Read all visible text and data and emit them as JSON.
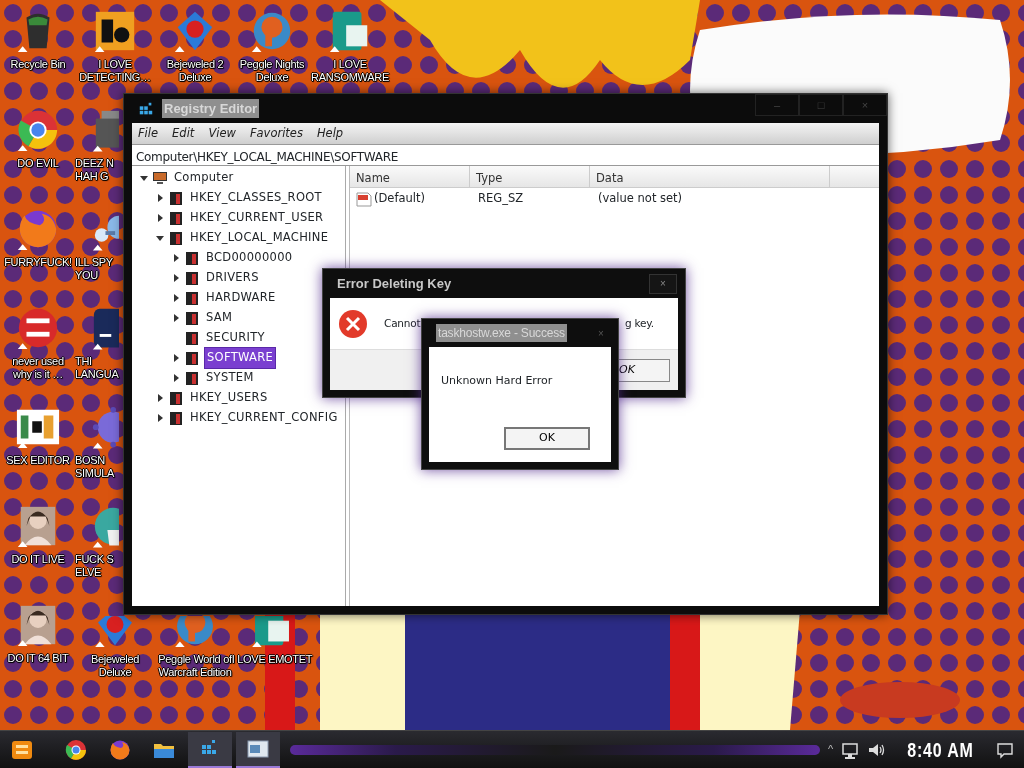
{
  "desktop": {
    "icons": [
      {
        "kind": "bin",
        "label": "Recycle Bin"
      },
      {
        "kind": "badge",
        "label": "I LOVE\nDETECTING…"
      },
      {
        "kind": "gem",
        "label": "Bejeweled 2\nDeluxe"
      },
      {
        "kind": "disc",
        "label": "Peggle Nights\nDeluxe"
      },
      {
        "kind": "sheet",
        "label": "I LOVE\nRANSOMWARE"
      },
      {
        "kind": "browser",
        "label": "DO EVIL"
      },
      {
        "kind": "stack",
        "label": "DEEZ N\nHAH G"
      },
      {
        "kind": "fox",
        "label": "FURRYFUCK!"
      },
      {
        "kind": "network",
        "label": "ILL SPY\nYOU"
      },
      {
        "kind": "redball",
        "label": "never used\nwhy is it …"
      },
      {
        "kind": "darktile",
        "label": "THI\nLANGUA"
      },
      {
        "kind": "hextile",
        "label": "SEX EDITOR"
      },
      {
        "kind": "spiky",
        "label": "BOSN\nSIMULA"
      },
      {
        "kind": "portrait",
        "label": "DO IT LIVE"
      },
      {
        "kind": "tealball",
        "label": "FUCK S\nELVE"
      },
      {
        "kind": "portrait",
        "label": "DO IT 64 BIT"
      },
      {
        "kind": "gem",
        "label": "Bejeweled\nDeluxe"
      },
      {
        "kind": "disc",
        "label": "Peggle World of\nWarcraft Edition"
      },
      {
        "kind": "sheet",
        "label": "I LOVE EMOTET"
      }
    ]
  },
  "registry_editor": {
    "title": "Registry Editor",
    "window_controls": [
      "–",
      "□",
      "×"
    ],
    "menu": [
      "File",
      "Edit",
      "View",
      "Favorites",
      "Help"
    ],
    "address": "Computer\\HKEY_LOCAL_MACHINE\\SOFTWARE",
    "tree": [
      {
        "label": "Computer",
        "kind": "computer",
        "has_subkeys": true,
        "expanded": true,
        "selected": false,
        "children": [
          {
            "label": "HKEY_CLASSES_ROOT",
            "has_subkeys": true,
            "expanded": false,
            "selected": false
          },
          {
            "label": "HKEY_CURRENT_USER",
            "has_subkeys": true,
            "expanded": false,
            "selected": false
          },
          {
            "label": "HKEY_LOCAL_MACHINE",
            "has_subkeys": true,
            "expanded": true,
            "selected": false,
            "children": [
              {
                "label": "BCD00000000",
                "has_subkeys": true,
                "expanded": false,
                "selected": false
              },
              {
                "label": "DRIVERS",
                "has_subkeys": true,
                "expanded": false,
                "selected": false
              },
              {
                "label": "HARDWARE",
                "has_subkeys": true,
                "expanded": false,
                "selected": false
              },
              {
                "label": "SAM",
                "has_subkeys": true,
                "expanded": false,
                "selected": false
              },
              {
                "label": "SECURITY",
                "has_subkeys": false,
                "selected": false
              },
              {
                "label": "SOFTWARE",
                "has_subkeys": true,
                "expanded": false,
                "selected": true
              },
              {
                "label": "SYSTEM",
                "has_subkeys": true,
                "expanded": false,
                "selected": false
              }
            ]
          },
          {
            "label": "HKEY_USERS",
            "has_subkeys": true,
            "expanded": false,
            "selected": false
          },
          {
            "label": "HKEY_CURRENT_CONFIG",
            "has_subkeys": true,
            "expanded": false,
            "selected": false
          }
        ]
      }
    ],
    "columns": [
      "Name",
      "Type",
      "Data"
    ],
    "rows": [
      {
        "name": "(Default)",
        "type": "REG_SZ",
        "data": "(value not set)"
      }
    ]
  },
  "error_dialog": {
    "title": "Error Deleting Key",
    "close": "×",
    "message_parts": [
      "Cannot",
      "g key."
    ],
    "button": "OK"
  },
  "success_dialog": {
    "title": "taskhostw.exe - Success",
    "close": "×",
    "message": "Unknown Hard Error",
    "button": "OK"
  },
  "taskbar": {
    "apps": [
      {
        "kind": "start",
        "running": false
      },
      {
        "kind": "browser",
        "running": false
      },
      {
        "kind": "fox",
        "running": false
      },
      {
        "kind": "folder",
        "running": false
      },
      {
        "kind": "registry",
        "running": true
      },
      {
        "kind": "window",
        "running": true
      }
    ],
    "tray_expand": "^",
    "clock": "8:40 AM"
  }
}
